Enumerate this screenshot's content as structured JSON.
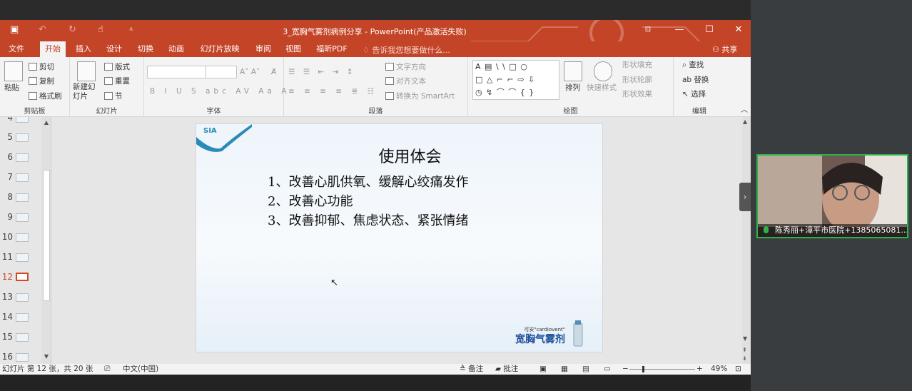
{
  "app": {
    "window_title": "3_宽胸气雾剂病例分享 - PowerPoint(产品激活失败)",
    "quick_access": [
      "save-icon",
      "undo-icon",
      "redo-icon",
      "touch-mode-icon",
      "customize-icon"
    ],
    "colors": {
      "accent": "#c44427",
      "selected": "#d04a29",
      "video_border": "#2db348"
    }
  },
  "menu": {
    "tabs": [
      "文件",
      "开始",
      "插入",
      "设计",
      "切换",
      "动画",
      "幻灯片放映",
      "审阅",
      "视图",
      "福昕PDF"
    ],
    "active_tab": "开始",
    "tell_me": "告诉我您想要做什么...",
    "share": "共享"
  },
  "ribbon": {
    "clipboard": {
      "label": "剪贴板",
      "paste": "粘贴",
      "cut": "剪切",
      "copy": "复制",
      "format_painter": "格式刷"
    },
    "slides": {
      "label": "幻灯片",
      "new_slide": "新建幻灯片",
      "layout": "版式",
      "reset": "重置",
      "section": "节"
    },
    "font": {
      "label": "字体",
      "font_name": "",
      "font_size": ""
    },
    "paragraph": {
      "label": "段落",
      "text_direction": "文字方向",
      "align_text": "对齐文本",
      "smartart": "转换为 SmartArt"
    },
    "drawing": {
      "label": "绘图",
      "shapes_row1": "A ▤ \\ \\ □ ○",
      "shapes_row2": "□ △ ⌐ ⌐ ⇨ ⇩",
      "shapes_row3": "◷ ↯ ⌒ ⌒ { }",
      "arrange": "排列",
      "quick_styles": "快速样式",
      "shape_fill": "形状填充",
      "shape_outline": "形状轮廓",
      "shape_effects": "形状效果"
    },
    "editing": {
      "label": "编辑",
      "find": "查找",
      "replace": "替换",
      "select": "选择"
    }
  },
  "thumbnails": {
    "numbers": [
      "4",
      "5",
      "6",
      "7",
      "8",
      "9",
      "10",
      "11",
      "12",
      "13",
      "14",
      "15",
      "16"
    ],
    "selected": "12"
  },
  "slide": {
    "logo_text": "SIA",
    "heading": "使用体会",
    "bullets": [
      "1、改善心肌供氧、缓解心绞痛发作",
      "2、改善心功能",
      "3、改善抑郁、焦虑状态、紧张情绪"
    ],
    "brand_en": "可安\"cardiovent\"",
    "brand_cn": "宽胸气雾剂"
  },
  "status": {
    "slide_info": "幻灯片 第 12 张，共 20 张",
    "language": "中文(中国)",
    "notes": "备注",
    "comments": "批注",
    "zoom": "49%"
  },
  "meeting": {
    "participant_name": "陈秀丽+漳平市医院+1385065081..."
  }
}
